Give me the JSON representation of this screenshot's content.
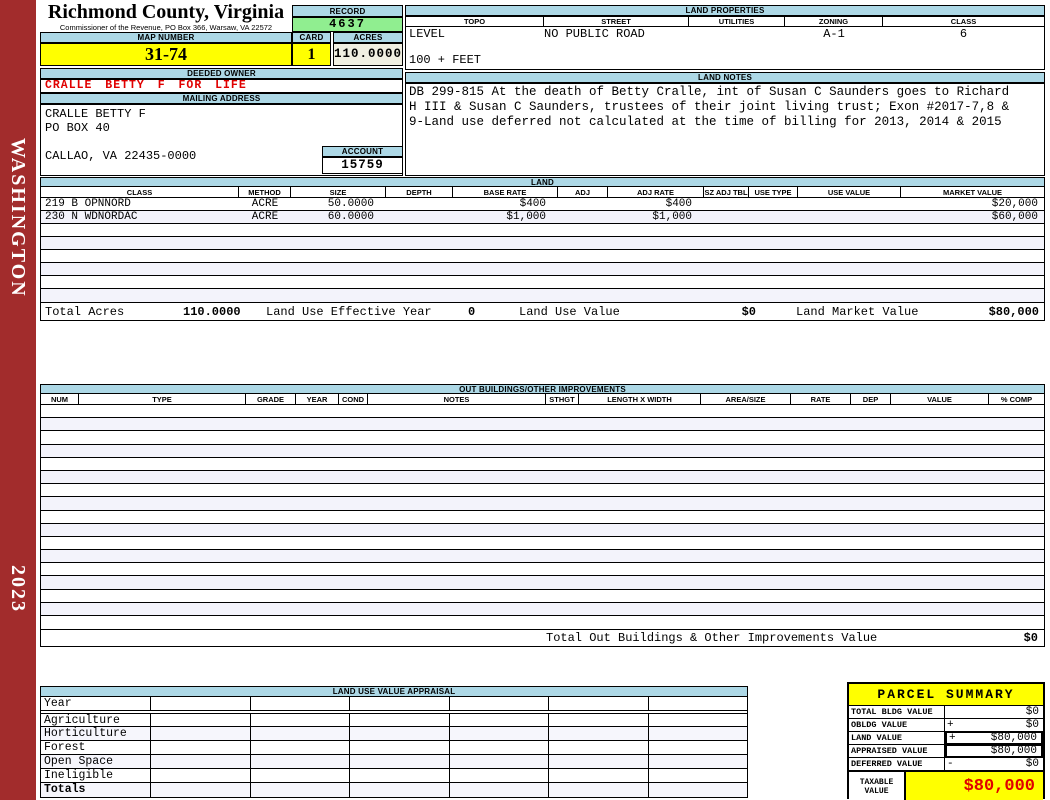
{
  "sidebar": {
    "district": "WASHINGTON",
    "year": "2023"
  },
  "header": {
    "county_name": "Richmond County, Virginia",
    "office_line": "Commissioner of the Revenue, PO Box 366, Warsaw, VA 22572",
    "record_label": "RECORD",
    "record_number": "4637",
    "map_number_label": "MAP NUMBER",
    "map_number": "31-74",
    "card_label": "CARD",
    "card_number": "1",
    "acres_label": "ACRES",
    "acres": "110.0000",
    "deeded_owner_label": "DEEDED OWNER",
    "deeded_owner": "CRALLE BETTY F FOR LIFE",
    "mailing_address_label": "MAILING ADDRESS",
    "mailing_address": [
      "CRALLE BETTY F",
      "PO BOX 40",
      "",
      "CALLAO, VA 22435-0000"
    ],
    "account_label": "ACCOUNT",
    "account_number": "15759"
  },
  "land_properties": {
    "title": "LAND PROPERTIES",
    "columns": [
      "TOPO",
      "STREET",
      "UTILITIES",
      "ZONING",
      "CLASS"
    ],
    "topo": "LEVEL",
    "street": "NO PUBLIC ROAD",
    "utilities": "",
    "zoning": "A-1",
    "class": "6",
    "topo_line2": "100 + FEET"
  },
  "land_notes": {
    "title": "LAND NOTES",
    "lines": [
      "DB 299-815 At the death of Betty Cralle, int of Susan C Saunders goes to Richard",
      "H III & Susan C Saunders, trustees of their joint living trust; Exon #2017-7,8 &",
      "9-Land use deferred not calculated at the time of billing for 2013, 2014 & 2015"
    ]
  },
  "land": {
    "title": "LAND",
    "columns": [
      "CLASS",
      "METHOD",
      "SIZE",
      "DEPTH",
      "BASE RATE",
      "ADJ",
      "ADJ RATE",
      "SZ ADJ TBL",
      "USE TYPE",
      "USE VALUE",
      "MARKET VALUE"
    ],
    "rows": [
      {
        "cells": [
          "219 B OPNNORD",
          "ACRE",
          "50.0000",
          "",
          "$400",
          "",
          "$400",
          "",
          "",
          "",
          "$20,000"
        ]
      },
      {
        "cells": [
          "230 N WDNORDAC",
          "ACRE",
          "60.0000",
          "",
          "$1,000",
          "",
          "$1,000",
          "",
          "",
          "",
          "$60,000"
        ]
      }
    ],
    "empty_row_count": 6,
    "totals": {
      "total_acres_label": "Total Acres",
      "total_acres": "110.0000",
      "effective_year_label": "Land Use Effective Year",
      "effective_year": "0",
      "use_value_label": "Land Use Value",
      "use_value": "$0",
      "market_value_label": "Land Market Value",
      "market_value": "$80,000"
    }
  },
  "out_buildings": {
    "title": "OUT BUILDINGS/OTHER IMPROVEMENTS",
    "columns": [
      "NUM",
      "TYPE",
      "GRADE",
      "YEAR",
      "COND",
      "NOTES",
      "STHGT",
      "LENGTH X WIDTH",
      "AREA/SIZE",
      "RATE",
      "DEP",
      "VALUE",
      "% COMP"
    ],
    "empty_row_count": 17,
    "total_label": "Total Out Buildings & Other Improvements Value",
    "total_value": "$0"
  },
  "appraisal": {
    "title": "LAND USE VALUE APPRAISAL",
    "row_labels": [
      "Year",
      "Agriculture",
      "Horticulture",
      "Forest",
      "Open Space",
      "Ineligible",
      "Totals"
    ],
    "data_col_count": 6
  },
  "parcel_summary": {
    "title": "PARCEL SUMMARY",
    "rows": [
      {
        "label": "TOTAL BLDG VALUE",
        "sign": "",
        "value": "$0"
      },
      {
        "label": "OBLDG VALUE",
        "sign": "+",
        "value": "$0"
      },
      {
        "label": "LAND VALUE",
        "sign": "+",
        "value": "$80,000"
      },
      {
        "label": "APPRAISED VALUE",
        "sign": "",
        "value": "$80,000"
      },
      {
        "label": "DEFERRED VALUE",
        "sign": "-",
        "value": "$0"
      }
    ],
    "taxable_label_line1": "TAXABLE",
    "taxable_label_line2": "VALUE",
    "taxable_value": "$80,000"
  },
  "colors": {
    "sidebar_red": "#A22C2C",
    "bar_blue": "#ADD8E6",
    "record_green": "#90EE90",
    "highlight_yellow": "#FFFF00",
    "acres_cream": "#F0EFE1",
    "alert_red": "#E00000",
    "stripe": "#F3F3FB"
  }
}
